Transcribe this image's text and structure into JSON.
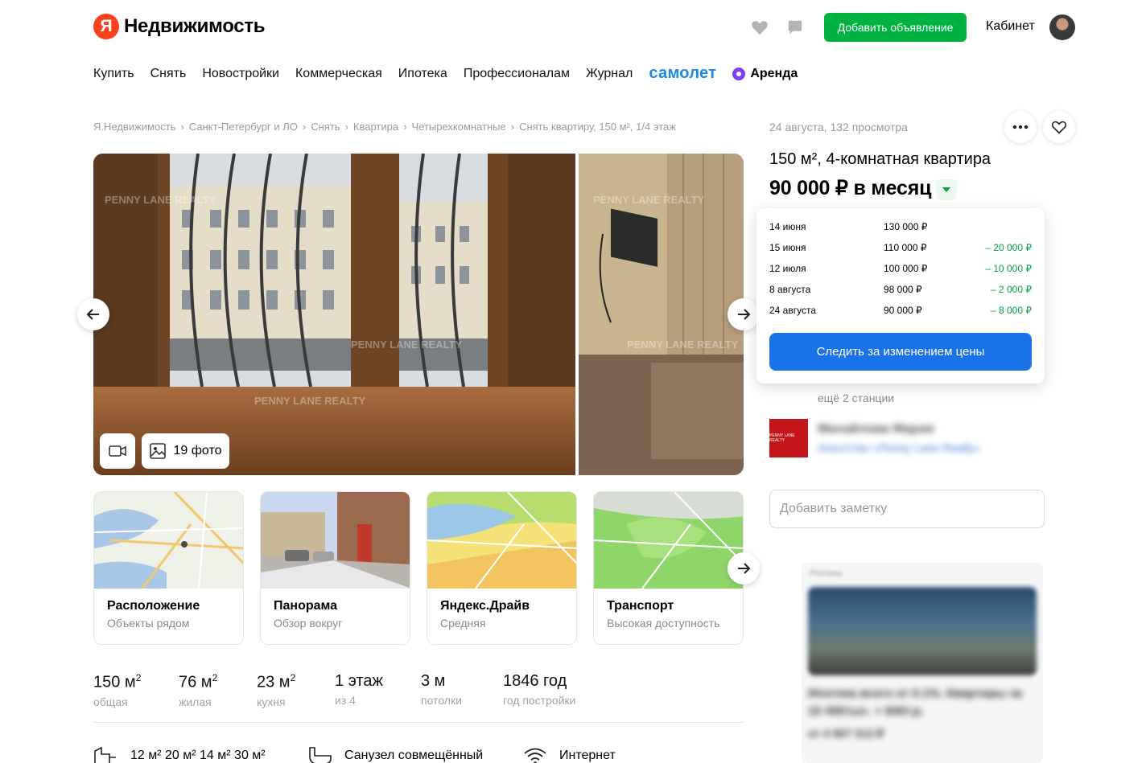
{
  "header": {
    "logo_letter": "Я",
    "logo_text": "Недвижимость",
    "add_button": "Добавить объявление",
    "cabinet": "Кабинет"
  },
  "nav": {
    "items": [
      "Купить",
      "Снять",
      "Новостройки",
      "Коммерческая",
      "Ипотека",
      "Профессионалам",
      "Журнал"
    ],
    "samolet": "самолет",
    "arenda": "Аренда"
  },
  "breadcrumbs": [
    "Я.Недвижимость",
    "Санкт-Петербург и ЛО",
    "Снять",
    "Квартира",
    "Четырехкомнатные",
    "Снять квартиру, 150 м², 1/4 этаж"
  ],
  "gallery": {
    "photos_label": "19 фото",
    "watermark": "PENNY LANE REALTY"
  },
  "cards": [
    {
      "title": "Расположение",
      "subtitle": "Объекты рядом"
    },
    {
      "title": "Панорама",
      "subtitle": "Обзор вокруг"
    },
    {
      "title": "Яндекс.Драйв",
      "subtitle": "Средняя"
    },
    {
      "title": "Транспорт",
      "subtitle": "Высокая доступность"
    }
  ],
  "stats": [
    {
      "value": "150 м",
      "sup": "2",
      "label": "общая"
    },
    {
      "value": "76 м",
      "sup": "2",
      "label": "жилая"
    },
    {
      "value": "23 м",
      "sup": "2",
      "label": "кухня"
    },
    {
      "value": "1 этаж",
      "sup": "",
      "label": "из 4"
    },
    {
      "value": "3 м",
      "sup": "",
      "label": "потолки"
    },
    {
      "value": "1846 год",
      "sup": "",
      "label": "год постройки"
    }
  ],
  "features": {
    "rooms": "12 м² 20 м² 14 м² 30 м²",
    "bathroom": "Санузел совмещённый",
    "internet": "Интернет"
  },
  "offer": {
    "meta": "24 августа, 132 просмотра",
    "title": "150 м², 4-комнатная квартира",
    "price": "90 000 ₽ в месяц"
  },
  "price_history": {
    "rows": [
      {
        "date": "14 июня",
        "price": "130 000 ₽",
        "change": ""
      },
      {
        "date": "15 июня",
        "price": "110 000 ₽",
        "change": "– 20 000 ₽"
      },
      {
        "date": "12 июля",
        "price": "100 000 ₽",
        "change": "– 10 000 ₽"
      },
      {
        "date": "8 августа",
        "price": "98 000 ₽",
        "change": "– 2 000 ₽"
      },
      {
        "date": "24 августа",
        "price": "90 000 ₽",
        "change": "– 8 000 ₽"
      }
    ],
    "follow_button": "Следить за изменением цены"
  },
  "metro": {
    "more_stations": "ещё 2 станции"
  },
  "agent": {
    "logo_text": "PENNY LANE REALTY",
    "name": "Михайлова Мария",
    "org": "Агентство «Penny Lane Realty»"
  },
  "note": {
    "placeholder": "Добавить заметку"
  },
  "ad": {
    "label": "Реклама",
    "headline": "Ипотека всего от 0.1%. Квартиры за 10 450тыс. + 840т.р.",
    "price": "от 4 907 312 ₽"
  },
  "colors": {
    "accent_green": "#00b341",
    "primary_blue": "#1a73e8",
    "brand_red": "#fc3f1d",
    "price_drop": "#00a23b"
  }
}
